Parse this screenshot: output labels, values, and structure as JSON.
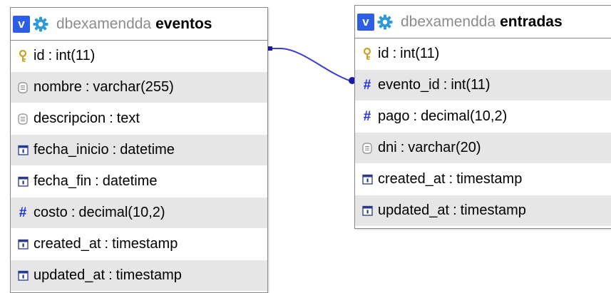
{
  "tables": [
    {
      "id": "eventos",
      "database": "dbexamendda",
      "name": "eventos",
      "columns": [
        {
          "name": "id",
          "type": "int(11)",
          "icon": "key-icon"
        },
        {
          "name": "nombre",
          "type": "varchar(255)",
          "icon": "text-field-icon"
        },
        {
          "name": "descripcion",
          "type": "text",
          "icon": "text-field-icon"
        },
        {
          "name": "fecha_inicio",
          "type": "datetime",
          "icon": "calendar-icon"
        },
        {
          "name": "fecha_fin",
          "type": "datetime",
          "icon": "calendar-icon"
        },
        {
          "name": "costo",
          "type": "decimal(10,2)",
          "icon": "numeric-icon"
        },
        {
          "name": "created_at",
          "type": "timestamp",
          "icon": "calendar-icon"
        },
        {
          "name": "updated_at",
          "type": "timestamp",
          "icon": "calendar-icon"
        }
      ]
    },
    {
      "id": "entradas",
      "database": "dbexamendda",
      "name": "entradas",
      "columns": [
        {
          "name": "id",
          "type": "int(11)",
          "icon": "key-icon"
        },
        {
          "name": "evento_id",
          "type": "int(11)",
          "icon": "numeric-icon"
        },
        {
          "name": "pago",
          "type": "decimal(10,2)",
          "icon": "numeric-icon"
        },
        {
          "name": "dni",
          "type": "varchar(20)",
          "icon": "text-field-icon"
        },
        {
          "name": "created_at",
          "type": "timestamp",
          "icon": "calendar-icon"
        },
        {
          "name": "updated_at",
          "type": "timestamp",
          "icon": "calendar-icon"
        }
      ]
    }
  ],
  "header_buttons": {
    "toggle_label": "v",
    "settings_icon": "gear-icon"
  },
  "relations": [
    {
      "from_table": "eventos",
      "from_column": "id",
      "to_table": "entradas",
      "to_column": "evento_id"
    }
  ],
  "colors": {
    "relation_line": "#3b3bd0",
    "header_button": "#2d5fe6",
    "gear": "#2f9ad8",
    "row_alt": "#e6e6e6",
    "database_text": "#8c8c8c",
    "numeric_hash": "#1a2fe8",
    "key": "#c9a227"
  }
}
